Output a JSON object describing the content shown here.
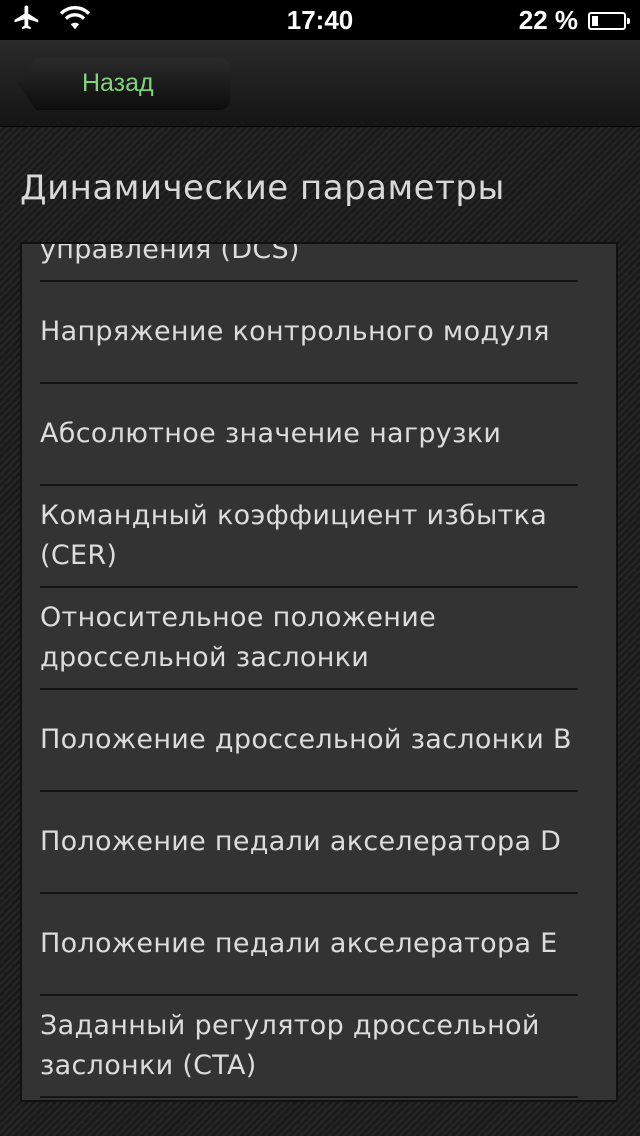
{
  "status_bar": {
    "time": "17:40",
    "battery_text": "22 %",
    "icons": [
      "airplane-icon",
      "wifi-icon",
      "battery-icon"
    ]
  },
  "nav": {
    "back_label": "Назад"
  },
  "section": {
    "title": "Динамические параметры"
  },
  "parameters": [
    "управления (DCS)",
    "Напряжение контрольного модуля",
    "Абсолютное значение нагрузки",
    "Командный коэффициент избытка (CER)",
    "Относительное положение дроссельной заслонки",
    "Положение дроссельной заслонки B",
    "Положение педали акселератора D",
    "Положение педали акселератора E",
    "Заданный регулятор дроссельной заслонки (CTA)"
  ],
  "colors": {
    "back_label": "#7fd67a",
    "list_background": "#333333"
  }
}
